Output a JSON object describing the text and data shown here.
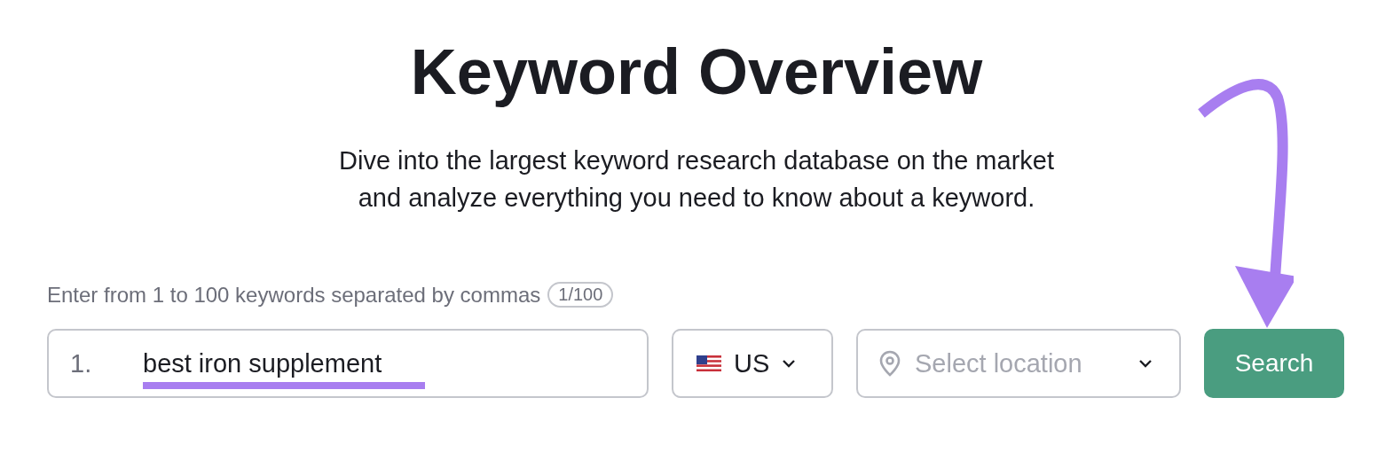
{
  "title": "Keyword Overview",
  "subtitle": [
    "Dive into the largest keyword research database on the market",
    "and analyze everything you need to know about a keyword."
  ],
  "keywords_field": {
    "label": "Enter from 1 to 100 keywords separated by commas",
    "count": "1/100",
    "line_number": "1.",
    "value": "best iron supplement"
  },
  "country_select": {
    "value": "US"
  },
  "location_select": {
    "placeholder": "Select location"
  },
  "search_button": {
    "label": "Search"
  }
}
